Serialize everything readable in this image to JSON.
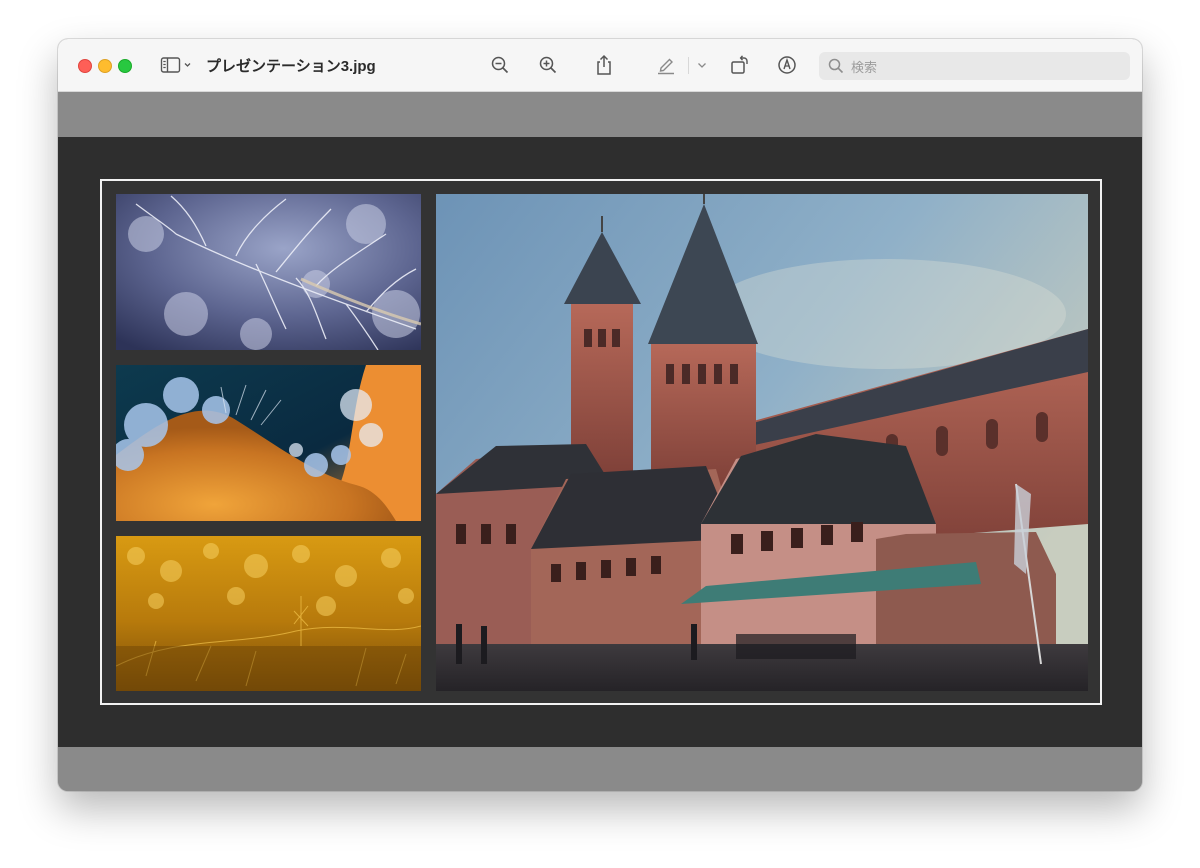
{
  "window": {
    "title": "プレゼンテーション3.jpg"
  },
  "toolbar": {
    "sidebar_icon": "sidebar-icon",
    "zoom_out_icon": "zoom-out-icon",
    "zoom_in_icon": "zoom-in-icon",
    "share_icon": "share-icon",
    "markup_icon": "highlighter-icon",
    "rotate_icon": "rotate-icon",
    "annotate_icon": "markup-pen-circle-icon"
  },
  "search": {
    "placeholder": "検索",
    "value": ""
  },
  "image": {
    "photos": [
      {
        "subject": "frost-branches-photo"
      },
      {
        "subject": "ice-crystals-photo"
      },
      {
        "subject": "golden-frost-photo"
      },
      {
        "subject": "cathedral-square-photo"
      }
    ]
  },
  "colors": {
    "close": "#fe5f57",
    "minimize": "#febc2e",
    "maximize": "#28c840",
    "canvas": "#2e2e2e",
    "chrome_gray": "#8a8a8a"
  }
}
